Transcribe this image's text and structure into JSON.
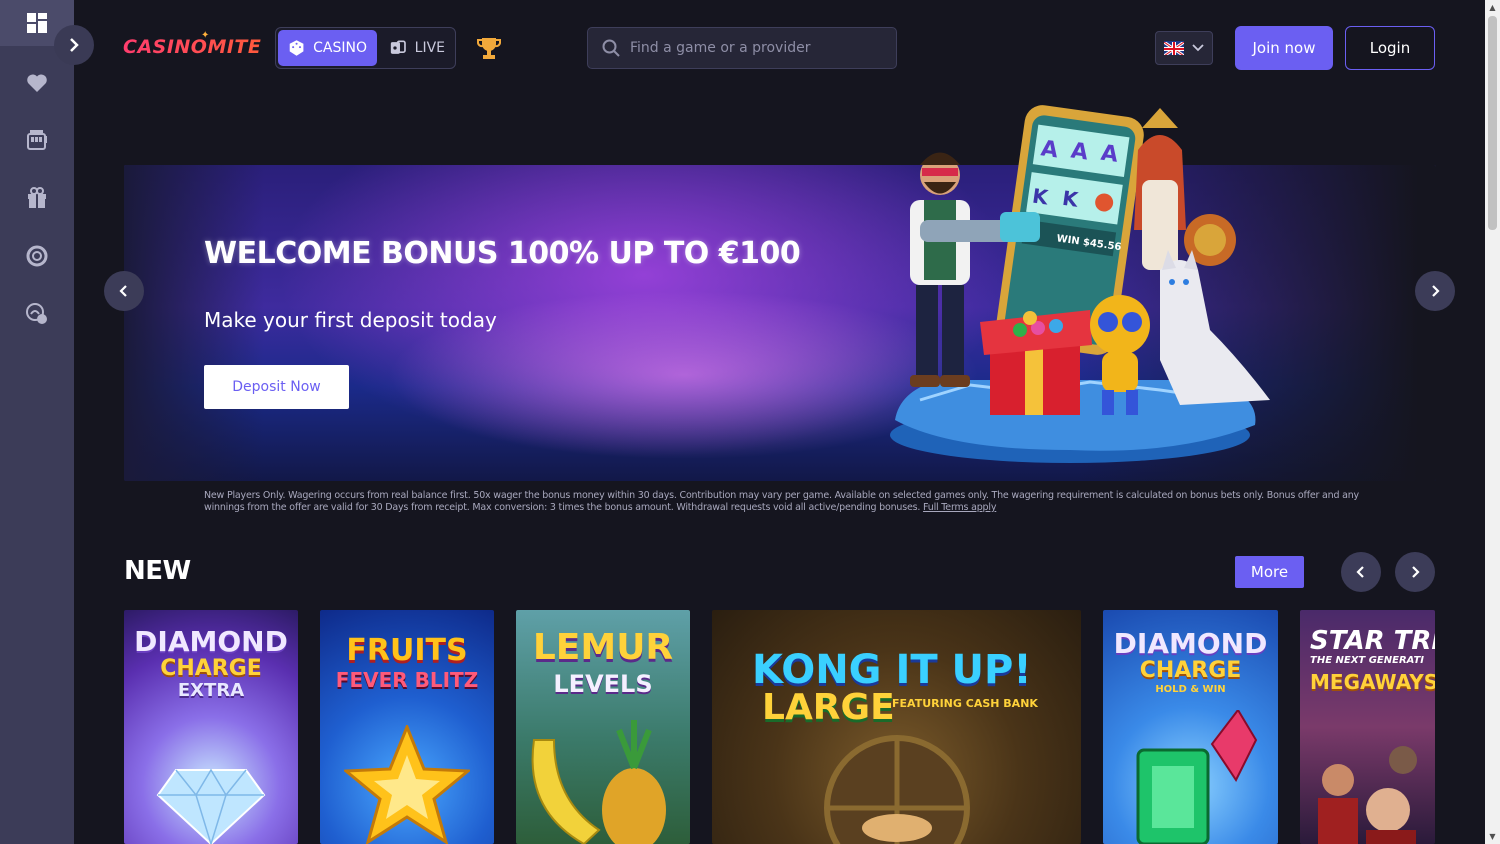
{
  "brand": {
    "logo_text": "CASINOMITE",
    "accent": "#6b5ff2",
    "logo_color": "#ff3d6e"
  },
  "sidebar": {
    "items": [
      {
        "icon": "dashboard-icon",
        "active": true
      },
      {
        "icon": "heart-icon"
      },
      {
        "icon": "slot-machine-icon"
      },
      {
        "icon": "gift-icon"
      },
      {
        "icon": "lifebuoy-icon"
      },
      {
        "icon": "support-chat-icon"
      }
    ]
  },
  "header": {
    "modes": {
      "casino_label": "CASINO",
      "live_label": "LIVE"
    },
    "search_placeholder": "Find a game or a provider",
    "language": "en-GB",
    "join_label": "Join now",
    "login_label": "Login"
  },
  "hero": {
    "title": "WELCOME BONUS 100% UP TO €100",
    "subtitle": "Make your first deposit today",
    "cta_label": "Deposit Now",
    "disclaimer": "New Players Only. Wagering occurs from real balance first. 50x wager the bonus money within 30 days. Contribution may vary per game. Available on selected games only. The wagering requirement is calculated on bonus bets only. Bonus offer and any winnings from the offer are valid for 30 Days from receipt. Max conversion: 3 times the bonus amount. Withdrawal requests void all active/pending bonuses.",
    "terms_link": "Full Terms apply",
    "phone_win_text": "WIN $45.56",
    "phone_reel_letters": [
      "A",
      "A",
      "A",
      "K",
      "K"
    ]
  },
  "new_section": {
    "title": "NEW",
    "more_label": "More",
    "games": [
      {
        "line1": "DIAMOND",
        "line2": "CHARGE",
        "line3": "EXTRA"
      },
      {
        "line1": "FRUITS",
        "line2": "FEVER BLITZ"
      },
      {
        "line1": "LEMUR",
        "line2": "LEVELS"
      },
      {
        "line1": "KONG IT UP!",
        "line2": "LARGE",
        "line3": "FEATURING CASH BANK"
      },
      {
        "line1": "DIAMOND",
        "line2": "CHARGE",
        "line3": "HOLD & WIN"
      },
      {
        "line1": "STAR TRE",
        "line2": "THE NEXT GENERATI",
        "line3": "MEGAWAYS"
      }
    ]
  }
}
